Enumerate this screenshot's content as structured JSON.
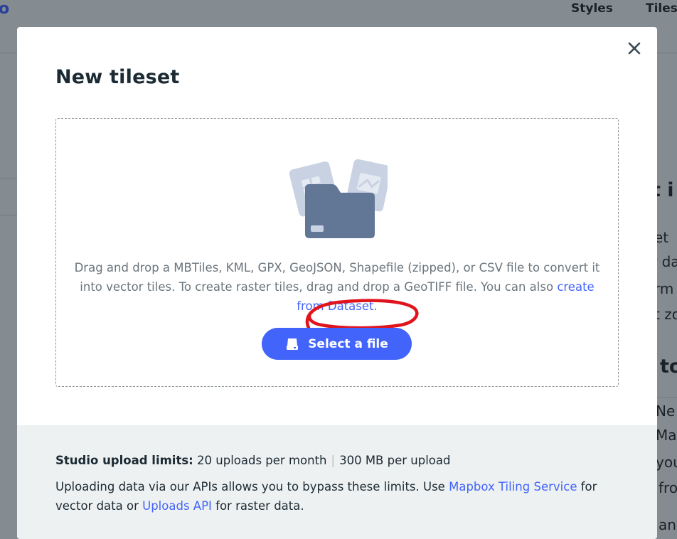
{
  "background": {
    "logo_fragment": "o",
    "nav": {
      "styles": "Styles",
      "tilesets": "Tilese"
    },
    "side_fragments": {
      "heading_1": "t i",
      "line_1": "et",
      "line_2": "r da",
      "line_3": "rm",
      "line_4": "t zo",
      "heading_2": "to",
      "line_5": "Ne",
      "line_6": "Ma",
      "line_7": "you",
      "line_8": "fro",
      "line_9": "an"
    }
  },
  "modal": {
    "title": "New tileset",
    "close_icon": "close-icon",
    "dropzone": {
      "text_before_link": "Drag and drop a MBTiles, KML, GPX, GeoJSON, Shapefile (zipped), or CSV file to convert it into vector tiles. To create raster tiles, drag and drop a GeoTIFF file. You can also ",
      "link_label": "create from Dataset",
      "text_after_link": ".",
      "button_label": "Select a file",
      "button_icon": "drive-icon",
      "illustration": "folder-upload-illustration"
    },
    "footer": {
      "limits_label": "Studio upload limits:",
      "uploads_per_month": "20 uploads per month",
      "separator": "|",
      "size_per_upload": "300 MB per upload",
      "api_text_1": "Uploading data via our APIs allows you to bypass these limits. Use ",
      "mts_link": "Mapbox Tiling Service",
      "api_text_2": " for vector data or ",
      "uploads_api_link": "Uploads API",
      "api_text_3": " for raster data."
    }
  },
  "colors": {
    "accent": "#4264fb",
    "annotation": "#e0141c",
    "overlay": "#848c91",
    "footer_bg": "#eef1f2"
  }
}
